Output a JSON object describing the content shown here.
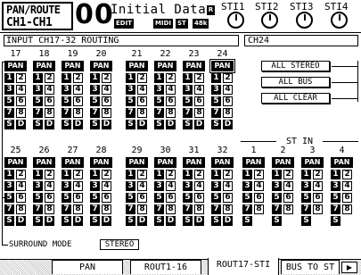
{
  "header": {
    "title_line1": "PAN/ROUTE",
    "title_line2": "CH1-CH1",
    "scene_number": "00",
    "scene_name": "Initial Data",
    "protect_label": "R",
    "badges": [
      "EDIT",
      "MIDI",
      "ST",
      "48k"
    ],
    "st_inputs": [
      "STI1",
      "STI2",
      "STI3",
      "STI4"
    ]
  },
  "screen_title": "INPUT CH17-32 ROUTING",
  "selected_channel": "CH24",
  "buttons": {
    "pan": "PAN",
    "bus_labels": [
      "1",
      "2",
      "3",
      "4",
      "5",
      "6",
      "7",
      "8"
    ],
    "direct": "D",
    "stereo": "S"
  },
  "rows": [
    {
      "channels": [
        "17",
        "18",
        "19",
        "20",
        "21",
        "22",
        "23",
        "24"
      ],
      "selected_index": 7
    },
    {
      "channels": [
        "25",
        "26",
        "27",
        "28",
        "29",
        "30",
        "31",
        "32"
      ],
      "selected_index": -1
    }
  ],
  "stin": {
    "label": "ST IN",
    "channels": [
      "1",
      "2",
      "3",
      "4"
    ]
  },
  "actions": {
    "all_stereo": "ALL STEREO",
    "all_bus": "ALL BUS",
    "all_clear": "ALL CLEAR"
  },
  "surround": {
    "label": "SURROUND MODE",
    "value": "STEREO"
  },
  "tabs": [
    {
      "label": "PAN",
      "active": false
    },
    {
      "label": "ROUT1-16",
      "active": false
    },
    {
      "label": "ROUT17-STI",
      "active": true
    },
    {
      "label": "BUS TO ST",
      "active": false
    }
  ],
  "tab_next_icon": "right-arrow-icon"
}
